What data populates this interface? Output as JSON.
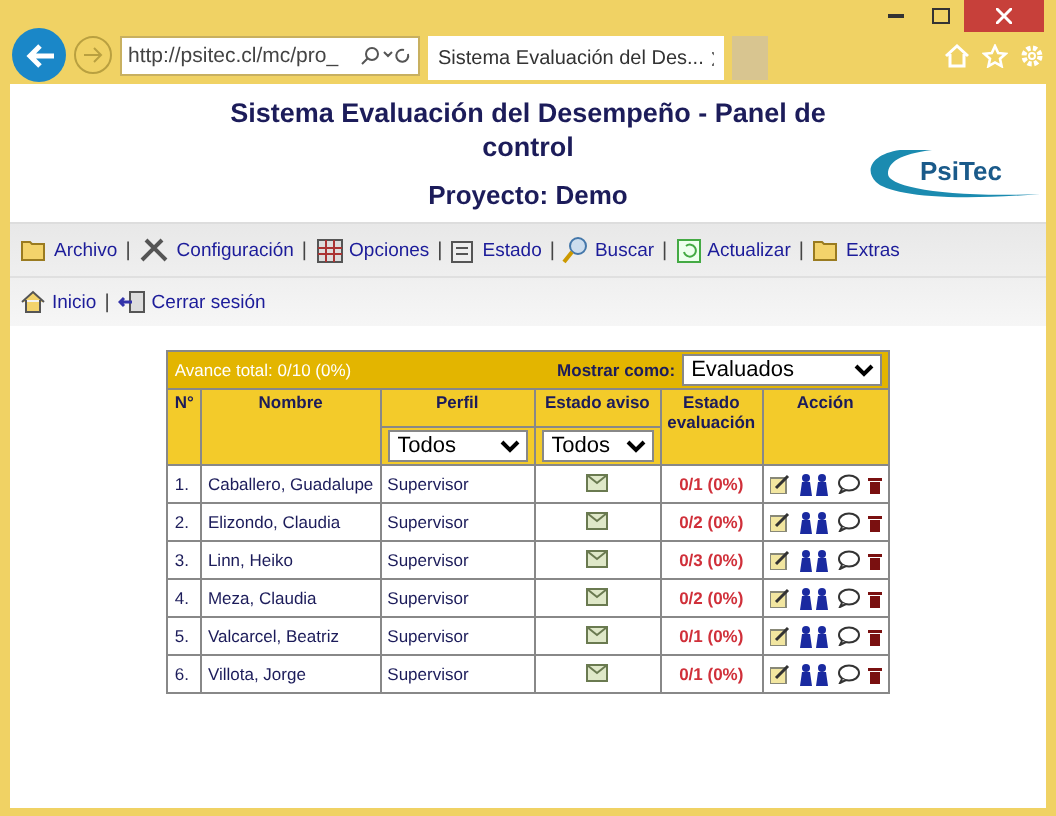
{
  "browser": {
    "address": "http://psitec.cl/mc/pro_",
    "tab_title": "Sistema Evaluación del Des..."
  },
  "header": {
    "title": "Sistema Evaluación del Desempeño - Panel de control",
    "logo": "PsiTec",
    "project": "Proyecto: Demo"
  },
  "menu": [
    {
      "kind": "link",
      "label": "Archivo"
    },
    {
      "kind": "separator",
      "label": "|"
    },
    {
      "kind": "link",
      "label": "Configuración"
    },
    {
      "kind": "separator",
      "label": "|"
    },
    {
      "kind": "link",
      "label": "Opciones"
    },
    {
      "kind": "separator",
      "label": "|"
    },
    {
      "kind": "link",
      "label": "Estado"
    },
    {
      "kind": "separator",
      "label": "|"
    },
    {
      "kind": "link",
      "label": "Buscar"
    },
    {
      "kind": "separator",
      "label": "|"
    },
    {
      "kind": "link",
      "label": "Actualizar"
    },
    {
      "kind": "separator",
      "label": "|"
    },
    {
      "kind": "link",
      "label": "Extras"
    }
  ],
  "menu2": [
    {
      "kind": "link",
      "label": "Inicio"
    },
    {
      "kind": "separator",
      "label": "|"
    },
    {
      "kind": "link",
      "label": "Cerrar sesión"
    }
  ],
  "panel": {
    "progress": "Avance total: 0/10 (0%)",
    "show_as_label": "Mostrar como:",
    "show_as": "Evaluados"
  },
  "table": {
    "columns": [
      "N°",
      "Nombre",
      "Perfil",
      "Estado aviso",
      "Estado evaluación",
      "Acción"
    ],
    "filters": {
      "perfil": "Todos",
      "aviso": "Todos"
    },
    "rows": [
      {
        "n": "1.",
        "name": "Caballero, Guadalupe",
        "profile": "Supervisor",
        "evaluation": "0/1 (0%)"
      },
      {
        "n": "2.",
        "name": "Elizondo, Claudia",
        "profile": "Supervisor",
        "evaluation": "0/2 (0%)"
      },
      {
        "n": "3.",
        "name": "Linn, Heiko",
        "profile": "Supervisor",
        "evaluation": "0/3 (0%)"
      },
      {
        "n": "4.",
        "name": "Meza, Claudia",
        "profile": "Supervisor",
        "evaluation": "0/2 (0%)"
      },
      {
        "n": "5.",
        "name": "Valcarcel, Beatriz",
        "profile": "Supervisor",
        "evaluation": "0/1 (0%)"
      },
      {
        "n": "6.",
        "name": "Villota, Jorge",
        "profile": "Supervisor",
        "evaluation": "0/1 (0%)"
      }
    ]
  }
}
